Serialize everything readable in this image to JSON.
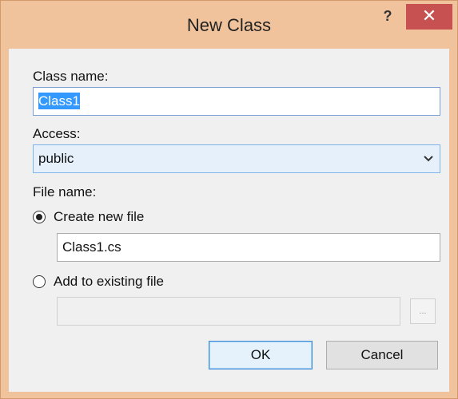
{
  "window": {
    "title": "New Class",
    "help_label": "?",
    "close_label": "✕"
  },
  "form": {
    "class_name_label": "Class name:",
    "class_name_value": "Class1",
    "access_label": "Access:",
    "access_value": "public",
    "file_name_label": "File name:",
    "create_new_file_label": "Create new file",
    "create_new_file_selected": true,
    "new_file_value": "Class1.cs",
    "add_existing_label": "Add to existing file",
    "add_existing_selected": false,
    "existing_file_value": "",
    "browse_label": "..."
  },
  "buttons": {
    "ok_label": "OK",
    "cancel_label": "Cancel"
  }
}
